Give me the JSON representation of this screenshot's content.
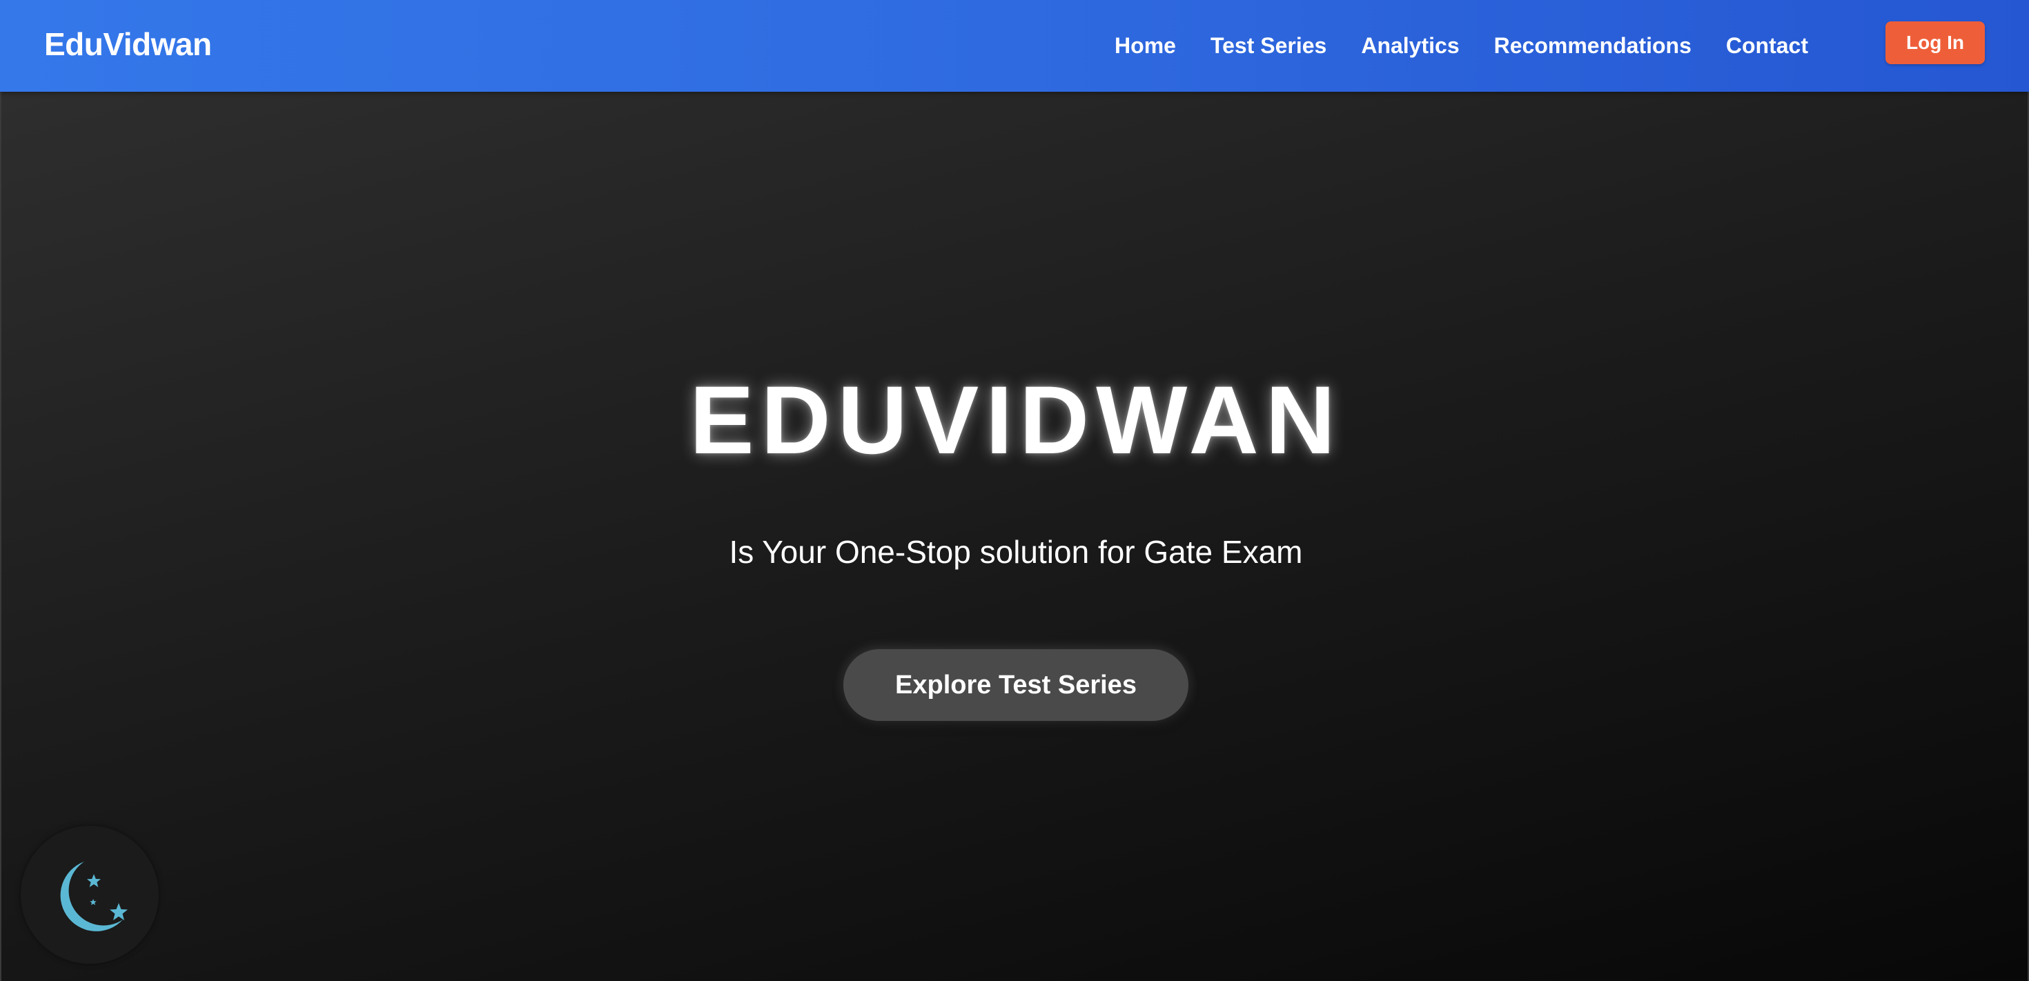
{
  "navbar": {
    "brand": "EduVidwan",
    "links": [
      {
        "label": "Home"
      },
      {
        "label": "Test Series"
      },
      {
        "label": "Analytics"
      },
      {
        "label": "Recommendations"
      },
      {
        "label": "Contact"
      }
    ],
    "login_label": "Log In"
  },
  "hero": {
    "title": "EDUVIDWAN",
    "subtitle": "Is Your One-Stop solution for Gate Exam",
    "cta_label": "Explore Test Series"
  },
  "theme_toggle": {
    "icon": "moon-stars-icon"
  },
  "colors": {
    "navbar_start": "#3478ea",
    "navbar_end": "#2557d2",
    "login_button": "#ee5f39",
    "hero_dark": "#1c1c1c",
    "cta_button": "#4a4a4a",
    "moon": "#5bb8d4"
  }
}
